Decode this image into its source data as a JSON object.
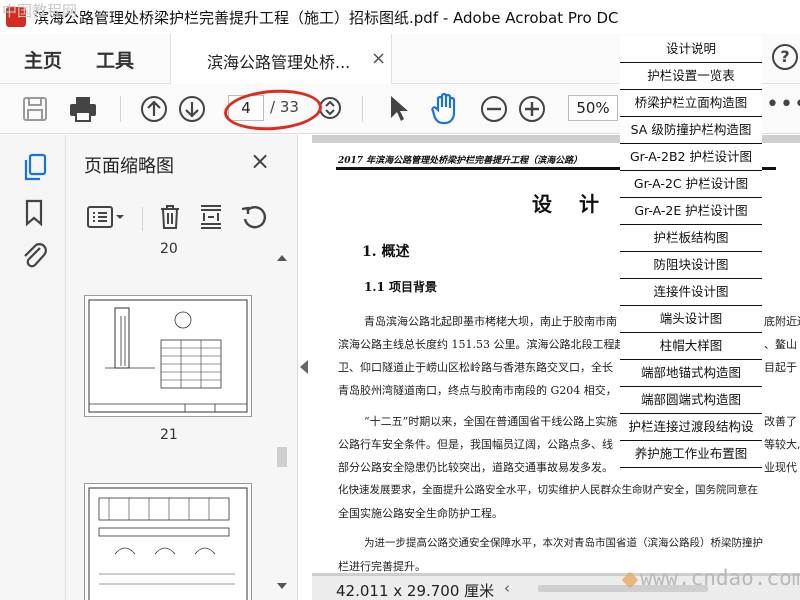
{
  "watermark": {
    "top_left": "中国教程网",
    "bottom_right": "www.cndao.com"
  },
  "window": {
    "title": "滨海公路管理处桥梁护栏完善提升工程（施工）招标图纸.pdf - Adobe Acrobat Pro DC"
  },
  "menubar": {
    "home": "主页",
    "tools": "工具",
    "tab_label": "滨海公路管理处桥...",
    "tab_close": "×",
    "help": "?"
  },
  "toolbar": {
    "current_page": "4",
    "total_pages": "/ 33",
    "zoom": "50%",
    "more": "•••"
  },
  "thumbnail_panel": {
    "title": "页面缩略图",
    "close": "×",
    "page_label_top": "20",
    "page_label_mid": "21"
  },
  "document": {
    "header": "2017 年滨海公路管理处桥梁护栏完善提升工程（滨海公路）",
    "title": "设 计 说",
    "h1": "1. 概述",
    "h2": "1.1 项目背景",
    "lines": [
      "青岛滨海公路北起即墨市栲栳大坝，南止于胶南市南",
      "滨海公路主线总长度约 151.53 公里。滨海公路北段工程起",
      "卫、仰口隧道止于崂山区松岭路与香港东路交叉口，全长",
      "青岛胶州湾隧道南口，终点与胶南市南段的 G204 相交，",
      "“十二五”时期以来，全国在普通国省干线公路上实施",
      "公路行车安全条件。但是，我国幅员辽阔，公路点多、线",
      "部分公路安全隐患仍比较突出，道路交通事故易发多发。",
      "化快速发展要求，全面提升公路安全水平，切实维护人民群众生命财产安全，国务院同意在",
      "全国实施公路安全生命防护工程。",
      "为进一步提高公路交通安全保障水平，本次对青岛市国省道（滨海公路段）桥梁防撞护",
      "栏进行完善提升。"
    ],
    "right_fragments": [
      "底附近边",
      "、鳌山",
      "目起于",
      "改善了",
      "等较大,",
      "业现代"
    ],
    "status_size": "42.011 x 29.700 厘米",
    "status_arrow": "‹"
  },
  "bookmarks": [
    "设计说明",
    "护栏设置一览表",
    "桥梁护栏立面构造图",
    "SA 级防撞护栏构造图",
    "Gr-A-2B2 护栏设计图",
    "Gr-A-2C 护栏设计图",
    "Gr-A-2E 护栏设计图",
    "护栏板结构图",
    "防阻块设计图",
    "连接件设计图",
    "端头设计图",
    "柱帽大样图",
    "端部地锚式构造图",
    "端部圆端式构造图",
    "护栏连接过渡段结构设",
    "养护施工作业布置图"
  ],
  "colors": {
    "annotation_red": "#e02a1e",
    "hand_tool_blue": "#1a73d9",
    "rail_icon_blue": "#1473e6"
  }
}
